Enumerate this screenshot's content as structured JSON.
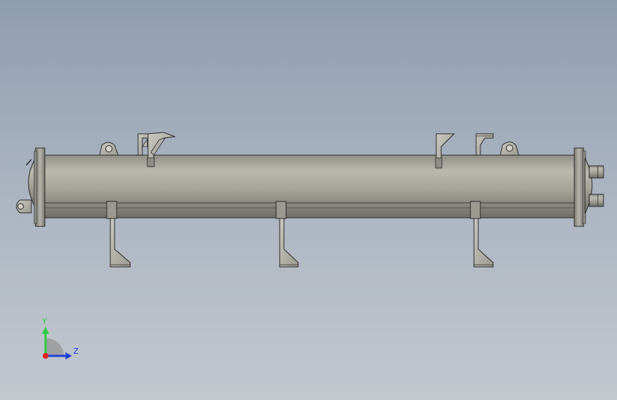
{
  "viewport": {
    "background_top": "#8f9db0",
    "background_bottom": "#c3c8cf"
  },
  "model": {
    "shell_color": "#a8a89e",
    "edge_color": "#2a2a2a",
    "support_leg_count": 3,
    "top_bracket_count": 4,
    "lifting_lug_count": 3,
    "nozzle_count": 2
  },
  "triad": {
    "y_label": "Y",
    "z_label": "Z",
    "y_color": "#2ecc40",
    "z_color": "#1f3fd6",
    "x_color": "#e02020"
  }
}
